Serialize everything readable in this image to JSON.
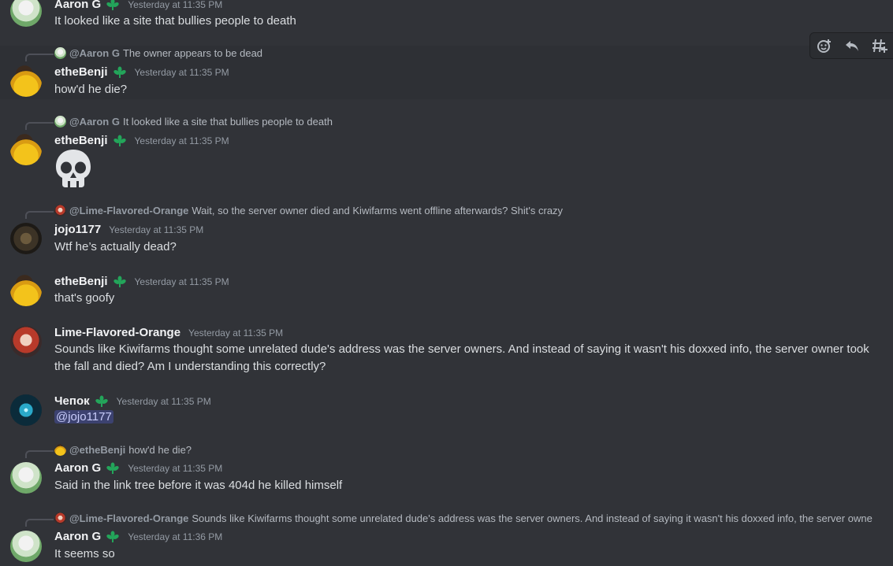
{
  "messages": [
    {
      "author": "Aaron G",
      "time": "Yesterday at 11:35 PM",
      "text": "It looked like a site that bullies people to death"
    },
    {
      "reply_author": "@Aaron G",
      "reply_text": "The owner appears to be dead",
      "author": "etheBenji",
      "time": "Yesterday at 11:35 PM",
      "text": "how'd he die?"
    },
    {
      "reply_author": "@Aaron G",
      "reply_text": "It looked like a site that bullies people to death",
      "author": "etheBenji",
      "time": "Yesterday at 11:35 PM",
      "emoji": "skull-emoji"
    },
    {
      "reply_author": "@Lime-Flavored-Orange",
      "reply_text": "Wait, so the server owner died and Kiwifarms went offline afterwards? Shit's crazy",
      "author": "jojo1177",
      "time": "Yesterday at 11:35 PM",
      "text": "Wtf he’s actually dead?"
    },
    {
      "author": "etheBenji",
      "time": "Yesterday at 11:35 PM",
      "text": "that's goofy"
    },
    {
      "author": "Lime-Flavored-Orange",
      "time": "Yesterday at 11:35 PM",
      "text_line1": "Sounds like Kiwifarms thought some unrelated dude's address was the server owners. And instead of saying it wasn't his doxxed info, the server owner took",
      "text_line2": "the fall and died? Am I understanding this correctly?"
    },
    {
      "author": "Чепок",
      "time": "Yesterday at 11:35 PM",
      "text": "@jojo1177"
    },
    {
      "reply_author": "@etheBenji",
      "reply_text": "how'd he die?",
      "author": "Aaron G",
      "time": "Yesterday at 11:35 PM",
      "text": "Said in the link tree before it was 404d he killed himself"
    },
    {
      "reply_author": "@Lime-Flavored-Orange",
      "reply_text": "Sounds like Kiwifarms thought some unrelated dude's address was the server owners. And instead of saying it wasn't his doxxed info, the server owne",
      "author": "Aaron G",
      "time": "Yesterday at 11:36 PM",
      "text": "It seems so"
    }
  ],
  "toolbar": {
    "icons": [
      "add-reaction-icon",
      "reply-icon",
      "create-thread-icon"
    ]
  },
  "colors": {
    "background": "#313338",
    "badge": "#23a55a",
    "mention_bg": "#3c4270"
  }
}
